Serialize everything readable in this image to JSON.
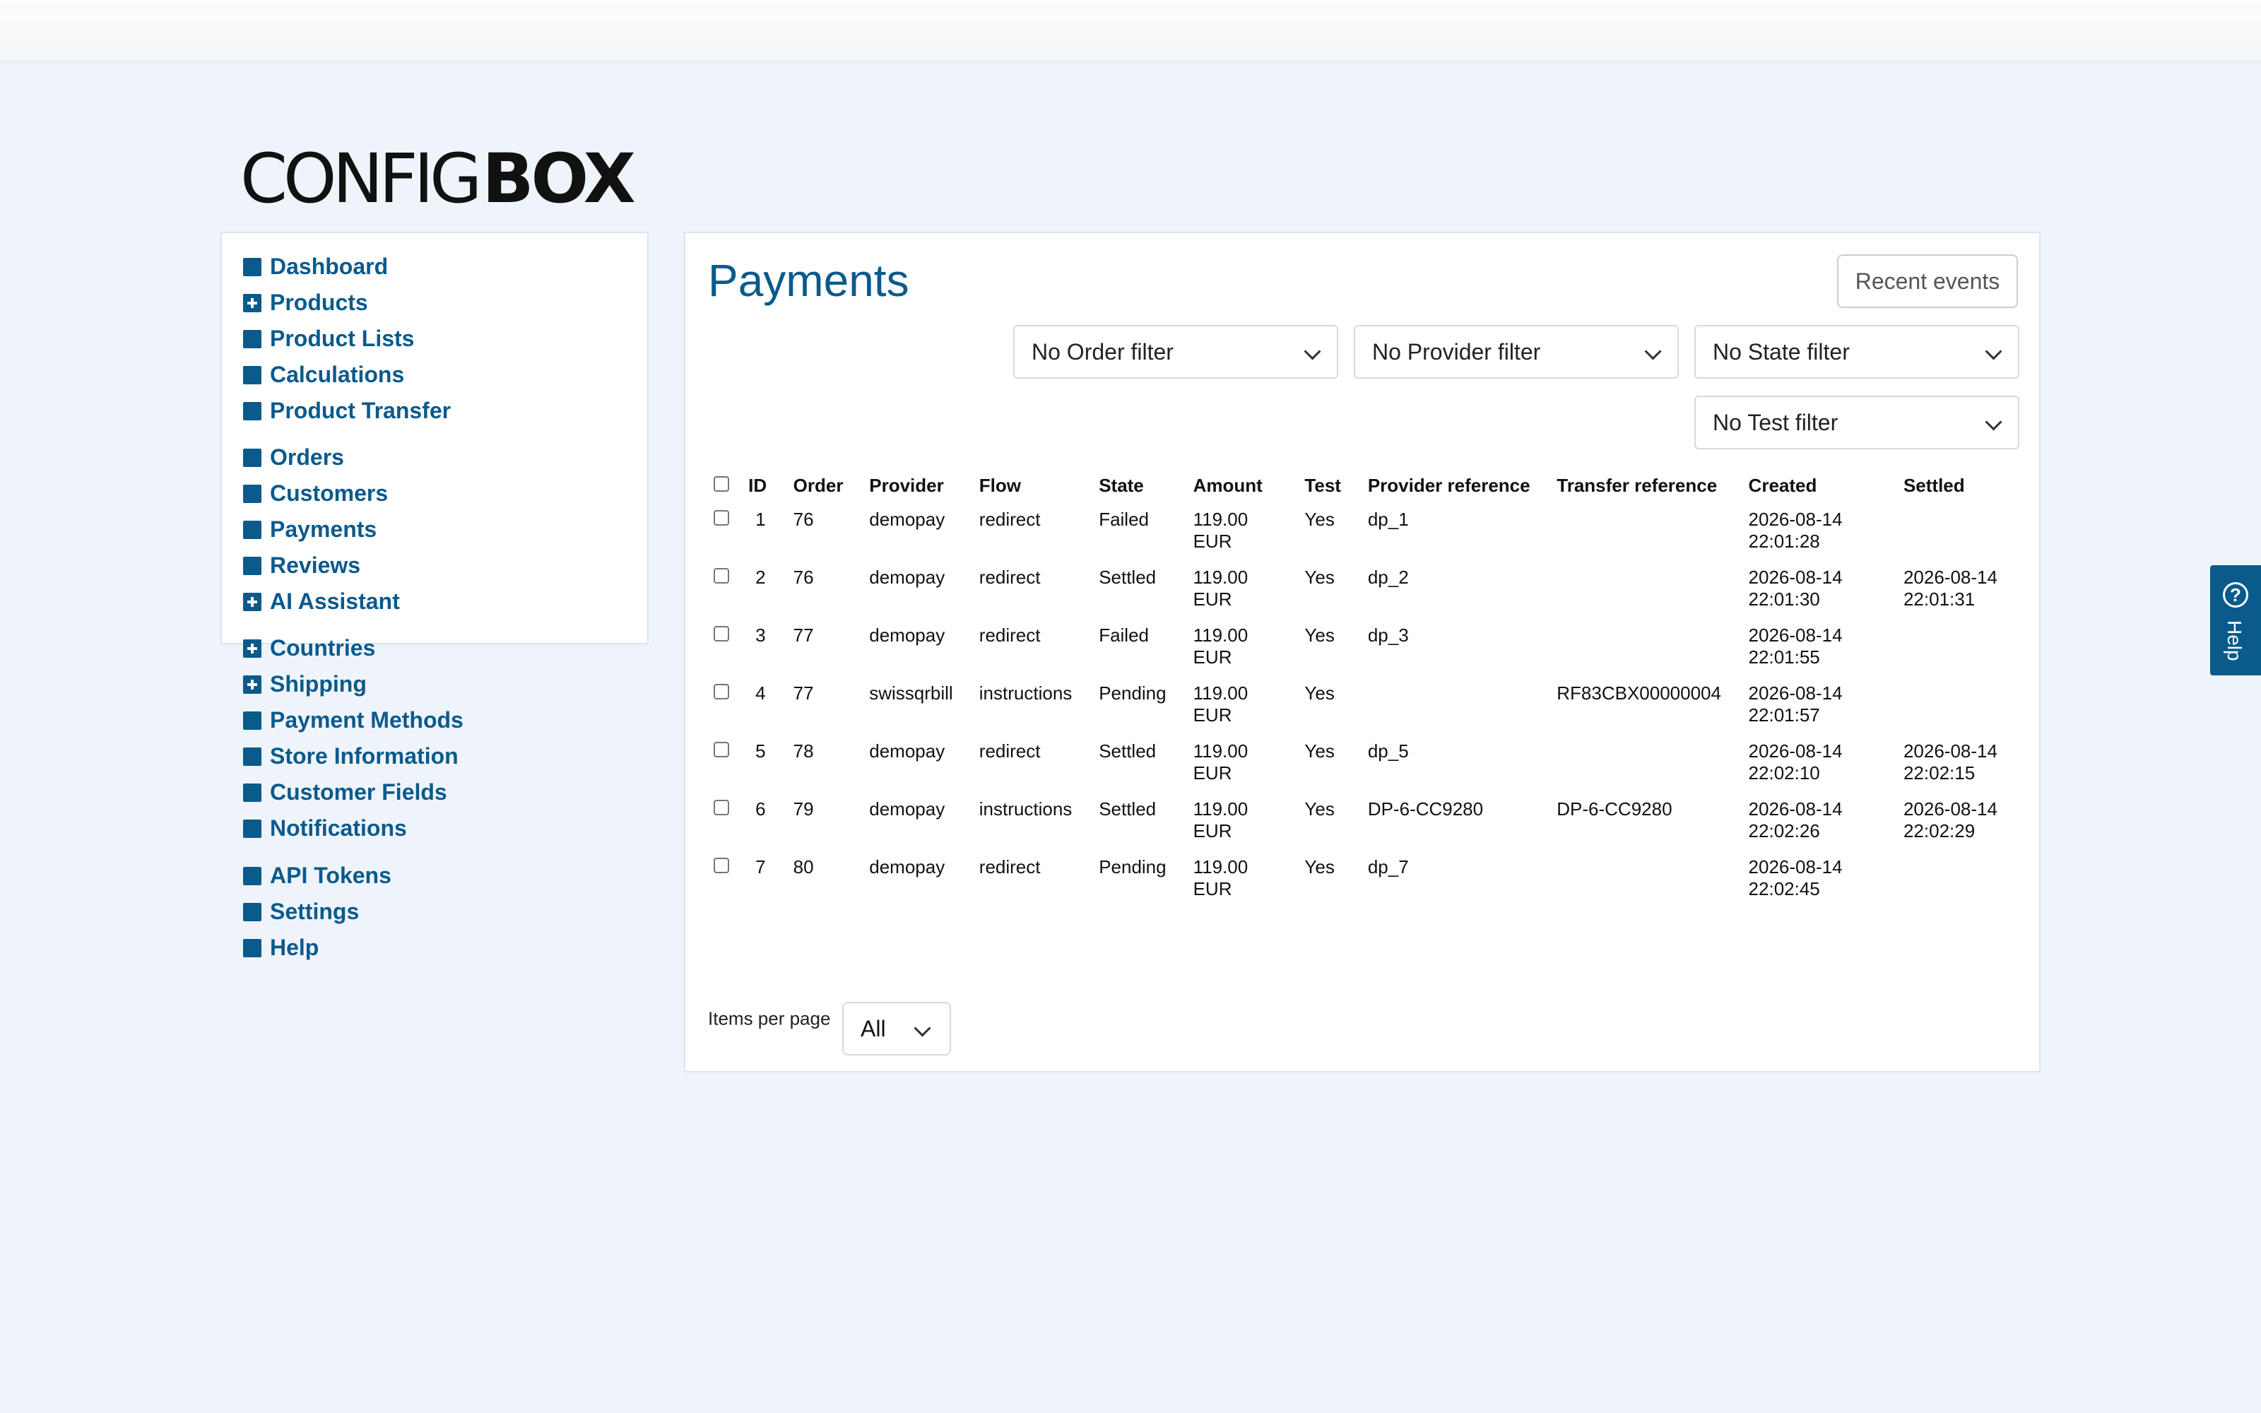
{
  "brand": {
    "logo_thin": "CONFIG",
    "logo_bold": "BOX"
  },
  "sidebar": {
    "groups": [
      [
        {
          "label": "Dashboard",
          "icon": "square-bullet"
        },
        {
          "label": "Products",
          "icon": "plus-square"
        },
        {
          "label": "Product Lists",
          "icon": "square-bullet"
        },
        {
          "label": "Calculations",
          "icon": "square-bullet"
        },
        {
          "label": "Product Transfer",
          "icon": "square-bullet"
        }
      ],
      [
        {
          "label": "Orders",
          "icon": "square-bullet"
        },
        {
          "label": "Customers",
          "icon": "square-bullet"
        },
        {
          "label": "Payments",
          "icon": "square-bullet"
        },
        {
          "label": "Reviews",
          "icon": "square-bullet"
        },
        {
          "label": "AI Assistant",
          "icon": "plus-square"
        }
      ],
      [
        {
          "label": "Countries",
          "icon": "plus-square"
        },
        {
          "label": "Shipping",
          "icon": "plus-square"
        },
        {
          "label": "Payment Methods",
          "icon": "square-bullet"
        },
        {
          "label": "Store Information",
          "icon": "square-bullet"
        },
        {
          "label": "Customer Fields",
          "icon": "square-bullet"
        },
        {
          "label": "Notifications",
          "icon": "square-bullet"
        }
      ],
      [
        {
          "label": "API Tokens",
          "icon": "square-bullet"
        },
        {
          "label": "Settings",
          "icon": "square-bullet"
        },
        {
          "label": "Help",
          "icon": "square-bullet"
        }
      ]
    ]
  },
  "main": {
    "title": "Payments",
    "recent_events_label": "Recent events",
    "filters": {
      "order": "No Order filter",
      "provider": "No Provider filter",
      "state": "No State filter",
      "test": "No Test filter"
    },
    "table": {
      "columns": [
        "ID",
        "Order",
        "Provider",
        "Flow",
        "State",
        "Amount",
        "Test",
        "Provider reference",
        "Transfer reference",
        "Created",
        "Settled"
      ],
      "rows": [
        {
          "id": "1",
          "order": "76",
          "provider": "demopay",
          "flow": "redirect",
          "state": "Failed",
          "amount": "119.00",
          "currency": "EUR",
          "test": "Yes",
          "provider_ref": "dp_1",
          "transfer_ref": "",
          "created_date": "2026-08-14",
          "created_time": "22:01:28",
          "settled_date": "",
          "settled_time": ""
        },
        {
          "id": "2",
          "order": "76",
          "provider": "demopay",
          "flow": "redirect",
          "state": "Settled",
          "amount": "119.00",
          "currency": "EUR",
          "test": "Yes",
          "provider_ref": "dp_2",
          "transfer_ref": "",
          "created_date": "2026-08-14",
          "created_time": "22:01:30",
          "settled_date": "2026-08-14",
          "settled_time": "22:01:31"
        },
        {
          "id": "3",
          "order": "77",
          "provider": "demopay",
          "flow": "redirect",
          "state": "Failed",
          "amount": "119.00",
          "currency": "EUR",
          "test": "Yes",
          "provider_ref": "dp_3",
          "transfer_ref": "",
          "created_date": "2026-08-14",
          "created_time": "22:01:55",
          "settled_date": "",
          "settled_time": ""
        },
        {
          "id": "4",
          "order": "77",
          "provider": "swissqrbill",
          "flow": "instructions",
          "state": "Pending",
          "amount": "119.00",
          "currency": "EUR",
          "test": "Yes",
          "provider_ref": "",
          "transfer_ref": "RF83CBX00000004",
          "created_date": "2026-08-14",
          "created_time": "22:01:57",
          "settled_date": "",
          "settled_time": ""
        },
        {
          "id": "5",
          "order": "78",
          "provider": "demopay",
          "flow": "redirect",
          "state": "Settled",
          "amount": "119.00",
          "currency": "EUR",
          "test": "Yes",
          "provider_ref": "dp_5",
          "transfer_ref": "",
          "created_date": "2026-08-14",
          "created_time": "22:02:10",
          "settled_date": "2026-08-14",
          "settled_time": "22:02:15"
        },
        {
          "id": "6",
          "order": "79",
          "provider": "demopay",
          "flow": "instructions",
          "state": "Settled",
          "amount": "119.00",
          "currency": "EUR",
          "test": "Yes",
          "provider_ref": "DP-6-CC9280",
          "transfer_ref": "DP-6-CC9280",
          "created_date": "2026-08-14",
          "created_time": "22:02:26",
          "settled_date": "2026-08-14",
          "settled_time": "22:02:29"
        },
        {
          "id": "7",
          "order": "80",
          "provider": "demopay",
          "flow": "redirect",
          "state": "Pending",
          "amount": "119.00",
          "currency": "EUR",
          "test": "Yes",
          "provider_ref": "dp_7",
          "transfer_ref": "",
          "created_date": "2026-08-14",
          "created_time": "22:02:45",
          "settled_date": "",
          "settled_time": ""
        }
      ]
    },
    "items_per_page_label": "Items per page",
    "items_per_page_value": "All"
  },
  "help_tab": {
    "label": "Help",
    "icon": "question-circle-icon"
  },
  "colors": {
    "brand_blue": "#0a5a8c",
    "background": "#eff4fb"
  }
}
